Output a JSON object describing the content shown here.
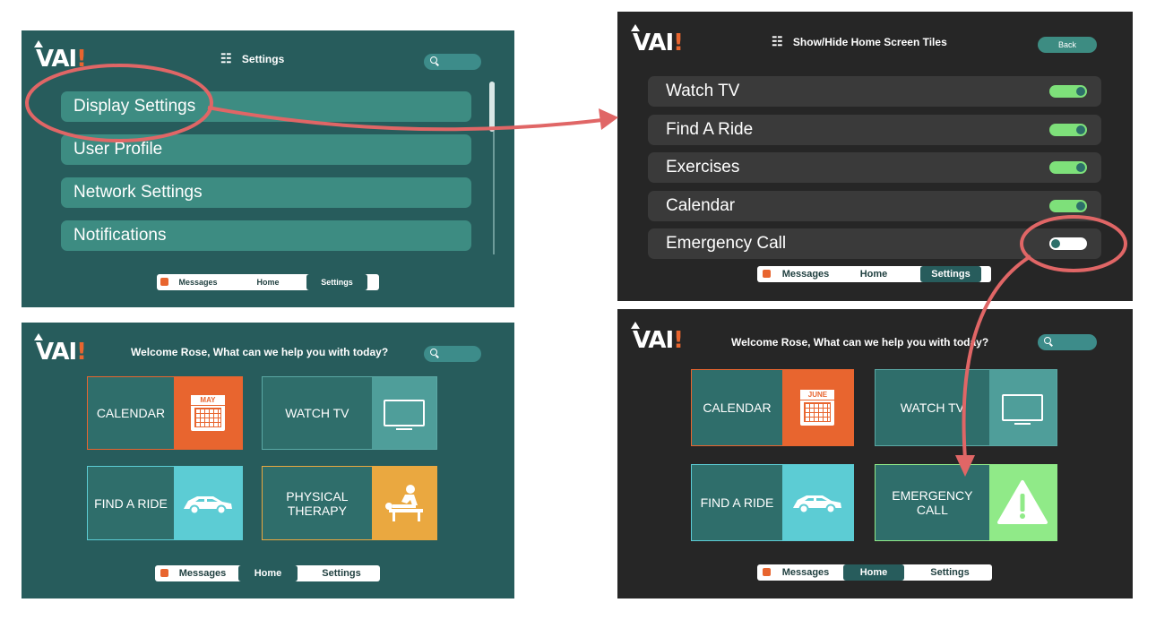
{
  "logo": {
    "text": "VAI",
    "accent": "!"
  },
  "settings_screen": {
    "header": "Settings",
    "menu": [
      "Display Settings",
      "User Profile",
      "Network Settings",
      "Notifications"
    ],
    "nav": {
      "messages": "Messages",
      "home": "Home",
      "settings": "Settings",
      "active": "settings"
    }
  },
  "tiles_screen": {
    "header": "Show/Hide Home Screen Tiles",
    "back": "Back",
    "rows": [
      {
        "label": "Watch TV",
        "on": true
      },
      {
        "label": "Find A Ride",
        "on": true
      },
      {
        "label": "Exercises",
        "on": true
      },
      {
        "label": "Calendar",
        "on": true
      },
      {
        "label": "Emergency Call",
        "on": false
      }
    ],
    "nav": {
      "messages": "Messages",
      "home": "Home",
      "settings": "Settings",
      "active": "settings"
    }
  },
  "home_teal": {
    "welcome": "Welcome Rose, What can we help you with today?",
    "tiles": {
      "calendar": {
        "label": "CALENDAR",
        "month": "MAY"
      },
      "watch_tv": {
        "label": "WATCH TV"
      },
      "find_ride": {
        "label": "FIND A RIDE"
      },
      "therapy": {
        "line1": "PHYSICAL",
        "line2": "THERAPY"
      }
    },
    "nav": {
      "messages": "Messages",
      "home": "Home",
      "settings": "Settings",
      "active": "home"
    }
  },
  "home_dark": {
    "welcome": "Welcome Rose, What can we help you with today?",
    "tiles": {
      "calendar": {
        "label": "CALENDAR",
        "month": "JUNE"
      },
      "watch_tv": {
        "label": "WATCH TV"
      },
      "find_ride": {
        "label": "FIND A RIDE"
      },
      "emergency": {
        "line1": "EMERGENCY",
        "line2": "CALL"
      }
    },
    "nav": {
      "messages": "Messages",
      "home": "Home",
      "settings": "Settings",
      "active": "home"
    }
  },
  "colors": {
    "teal_bg": "#275c5c",
    "dark_bg": "#262626",
    "brand_orange": "#e8652f",
    "toggle_on": "#7ee07a",
    "annotation_red": "#e06666",
    "ride_cyan": "#5cccd4",
    "therapy_gold": "#eaa840",
    "emergency_green": "#90ea88"
  }
}
